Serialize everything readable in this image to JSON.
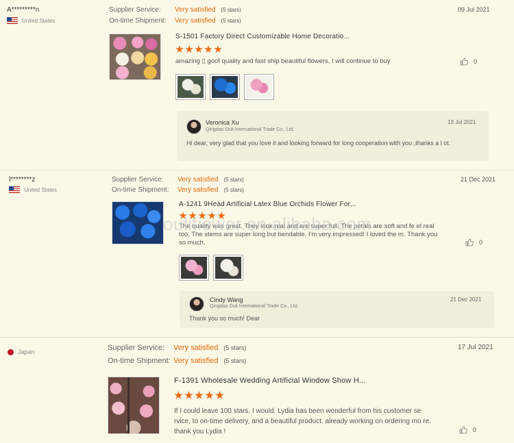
{
  "reviews": [
    {
      "buyer": "A*********n",
      "country": "United States",
      "supplier_service_label": "Supplier Service:",
      "supplier_service_value": "Very satisfied",
      "supplier_service_stars": "(5 stars)",
      "shipment_label": "On-time Shipment:",
      "shipment_value": "Very satisfied",
      "shipment_stars": "(5 stars)",
      "date": "09 Jul 2021",
      "product_title": "S-1501 Factory Direct Customizable Home Decoratio...",
      "rating": 5,
      "comment": "amazing ▯ goof quality and fast ship beautiful flowers, I will continue to buy",
      "likes": "0",
      "reply": {
        "name": "Veronica Xu",
        "company": "Qingdao Ouli International Trade Co., Ltd.",
        "date": "13 Jul 2021",
        "text": "Hi dear, very glad that you love it and looking forward for long cooperation with you ,thanks a l ot."
      }
    },
    {
      "buyer": "l********z",
      "country": "United States",
      "supplier_service_label": "Supplier Service:",
      "supplier_service_value": "Very satisfied",
      "supplier_service_stars": "(5 stars)",
      "shipment_label": "On-time Shipment:",
      "shipment_value": "Very satisfied",
      "shipment_stars": "(5 stars)",
      "date": "21 Dec 2021",
      "product_title": "A-1241 9Head Artificial Latex Blue Orchids Flower For...",
      "rating": 5,
      "comment": "The quality was great. They look real and are super full. The petals are soft and fe el real too. The stems are super long but bendable. I'm very impressed! I loved the m. Thank you so much.",
      "likes": "0",
      "reply": {
        "name": "Cindy Wang",
        "company": "Qingdao Ouli International Trade Co., Ltd.",
        "date": "21 Dec 2021",
        "text": "Thank you so much! Dear"
      }
    },
    {
      "buyer": "",
      "country": "Japan",
      "supplier_service_label": "Supplier Service:",
      "supplier_service_value": "Very satisfied",
      "supplier_service_stars": "(5 stars)",
      "shipment_label": "On-time Shipment:",
      "shipment_value": "Very satisfied",
      "shipment_stars": "(5 stars)",
      "date": "17 Jul 2021",
      "product_title": "F-1391 Wholesale Wedding Artificial Window Show H...",
      "rating": 5,
      "comment": "If I could leave 100 stars, I would. Lydia has been wonderful from his customer se rvice, to on-time delivery, and a beautiful product. already working on ordering mo re. thank you Lydia !",
      "likes": "0"
    }
  ],
  "watermark": "oulifiower.en.alibaba.com",
  "colors": {
    "accent": "#e56a0a",
    "star": "#f06a0c",
    "background": "#fbf8e8"
  }
}
